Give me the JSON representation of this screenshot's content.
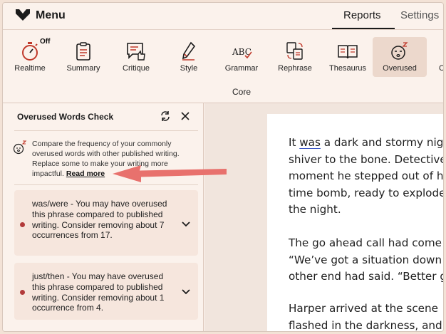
{
  "header": {
    "menu_label": "Menu",
    "tabs": [
      {
        "label": "Reports",
        "active": true
      },
      {
        "label": "Settings",
        "active": false
      }
    ]
  },
  "toolbar": {
    "items": [
      {
        "label": "Realtime",
        "icon": "stopwatch-icon",
        "badge": "Off"
      },
      {
        "label": "Summary",
        "icon": "clipboard-icon"
      },
      {
        "label": "Critique",
        "icon": "thumbs-up-chat-icon"
      },
      {
        "label": "Style",
        "icon": "pen-icon"
      },
      {
        "label": "Grammar",
        "icon": "abc-icon",
        "icon_text": "ABC"
      },
      {
        "label": "Rephrase",
        "icon": "rephrase-icon"
      },
      {
        "label": "Thesaurus",
        "icon": "book-icon"
      },
      {
        "label": "Overused",
        "icon": "sleepy-face-icon",
        "active": true
      },
      {
        "label": "C",
        "icon": "partial-icon"
      }
    ],
    "group_label": "Core"
  },
  "sidebar": {
    "title": "Overused Words Check",
    "intro": {
      "text": "Compare the frequency of your commonly overused words with other published writing. Replace some to make your writing more impactful.",
      "link": "Read more"
    },
    "cards": [
      {
        "text": "was/were - You may have overused this phrase compared to published writing. Consider removing about 7 occurrences from 17."
      },
      {
        "text": "just/then - You may have overused this phrase compared to published writing. Consider removing about 1 occurrence from 4."
      }
    ]
  },
  "document": {
    "paragraphs": [
      {
        "lines": [
          "It ",
          "was",
          " a dark and stormy nig",
          "shiver to the bone. Detective",
          "moment he stepped out of h",
          "time bomb, ready to explode",
          "the night."
        ]
      },
      {
        "lines": [
          "The go ahead call had come",
          "“We’ve got a situation down",
          "other end had said. “Better g"
        ]
      },
      {
        "lines": [
          "Harper arrived at the scene",
          "flashed in the darkness, and"
        ]
      }
    ]
  },
  "colors": {
    "accent": "#b23a3a",
    "arrow": "#e8716d",
    "underline": "#3a55c5",
    "background": "#fbf2ec"
  }
}
